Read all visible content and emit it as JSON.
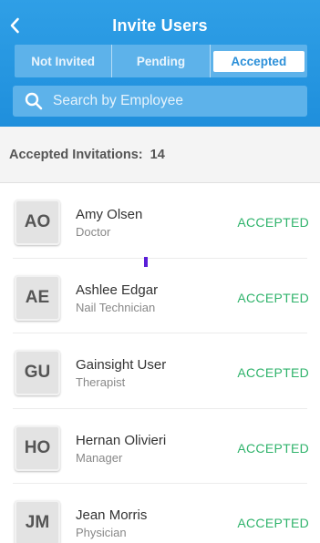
{
  "header": {
    "title": "Invite Users",
    "back_icon": "chevron-left-icon"
  },
  "tabs": [
    {
      "label": "Not Invited",
      "active": false
    },
    {
      "label": "Pending",
      "active": false
    },
    {
      "label": "Accepted",
      "active": true
    }
  ],
  "search": {
    "placeholder": "Search by Employee",
    "icon": "search-icon"
  },
  "summary": {
    "label": "Accepted Invitations:",
    "count": "14"
  },
  "users": [
    {
      "initials": "AO",
      "name": "Amy Olsen",
      "role": "Doctor",
      "status": "ACCEPTED"
    },
    {
      "initials": "AE",
      "name": "Ashlee Edgar",
      "role": "Nail Technician",
      "status": "ACCEPTED"
    },
    {
      "initials": "GU",
      "name": "Gainsight User",
      "role": "Therapist",
      "status": "ACCEPTED"
    },
    {
      "initials": "HO",
      "name": "Hernan Olivieri",
      "role": "Manager",
      "status": "ACCEPTED"
    },
    {
      "initials": "JM",
      "name": "Jean Morris",
      "role": "Physician",
      "status": "ACCEPTED"
    }
  ],
  "colors": {
    "header": "#2f9fe6",
    "accepted_status": "#2fb36b",
    "tab_active_text": "#2b8fd8"
  }
}
